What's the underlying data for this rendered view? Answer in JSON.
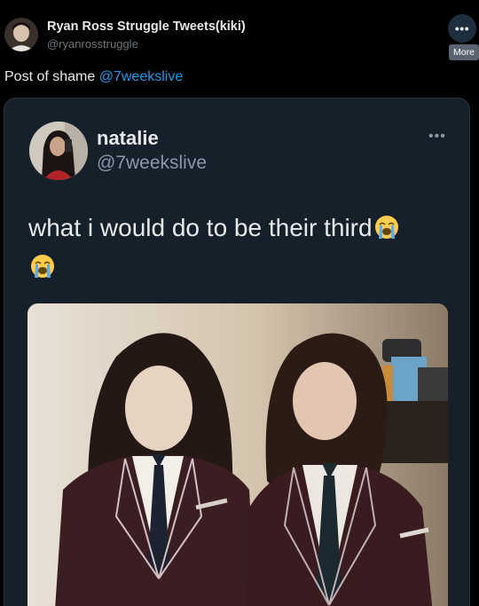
{
  "header": {
    "name": "Ryan Ross Struggle Tweets(kiki)",
    "handle": "@ryanrosstruggle",
    "more_label": "More"
  },
  "post": {
    "text_prefix": "Post of shame ",
    "mention": "@7weekslive"
  },
  "quoted": {
    "name": "natalie",
    "handle": "@7weekslive",
    "text": "what i would do to be their third"
  },
  "icons": {
    "more": "more-horizontal-icon",
    "quoted_more": "more-horizontal-icon",
    "emoji": "loudly-crying-face-icon"
  },
  "colors": {
    "background": "#000000",
    "card": "#16202a",
    "mention": "#1d9bf0",
    "secondary_text": "#71767b"
  }
}
